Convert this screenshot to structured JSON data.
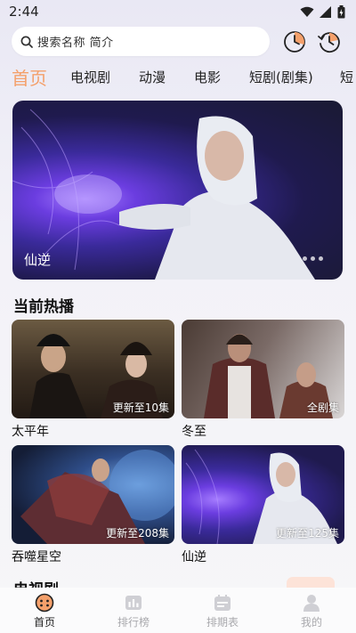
{
  "status_bar": {
    "time": "2:44"
  },
  "search": {
    "placeholder": "搜索名称 简介"
  },
  "tabs": [
    {
      "label": "首页",
      "active": true
    },
    {
      "label": "电视剧"
    },
    {
      "label": "动漫"
    },
    {
      "label": "电影"
    },
    {
      "label": "短剧(剧集)"
    },
    {
      "label": "短"
    }
  ],
  "banner": {
    "caption": "仙逆"
  },
  "section_hot": {
    "title": "当前热播",
    "cards": [
      {
        "title": "太平年",
        "badge": "更新至10集"
      },
      {
        "title": "冬至",
        "badge": "全剧集"
      },
      {
        "title": "吞噬星空",
        "badge": "更新至208集"
      },
      {
        "title": "仙逆",
        "badge": "更新至125集"
      }
    ]
  },
  "section_next": {
    "title": "电视剧"
  },
  "bottom_nav": [
    {
      "label": "首页",
      "icon": "home-icon",
      "active": true
    },
    {
      "label": "排行榜",
      "icon": "ranking-icon"
    },
    {
      "label": "排期表",
      "icon": "calendar-icon"
    },
    {
      "label": "我的",
      "icon": "profile-icon"
    }
  ],
  "colors": {
    "accent": "#f4a06b",
    "inactive_nav": "#a9a9ad"
  }
}
